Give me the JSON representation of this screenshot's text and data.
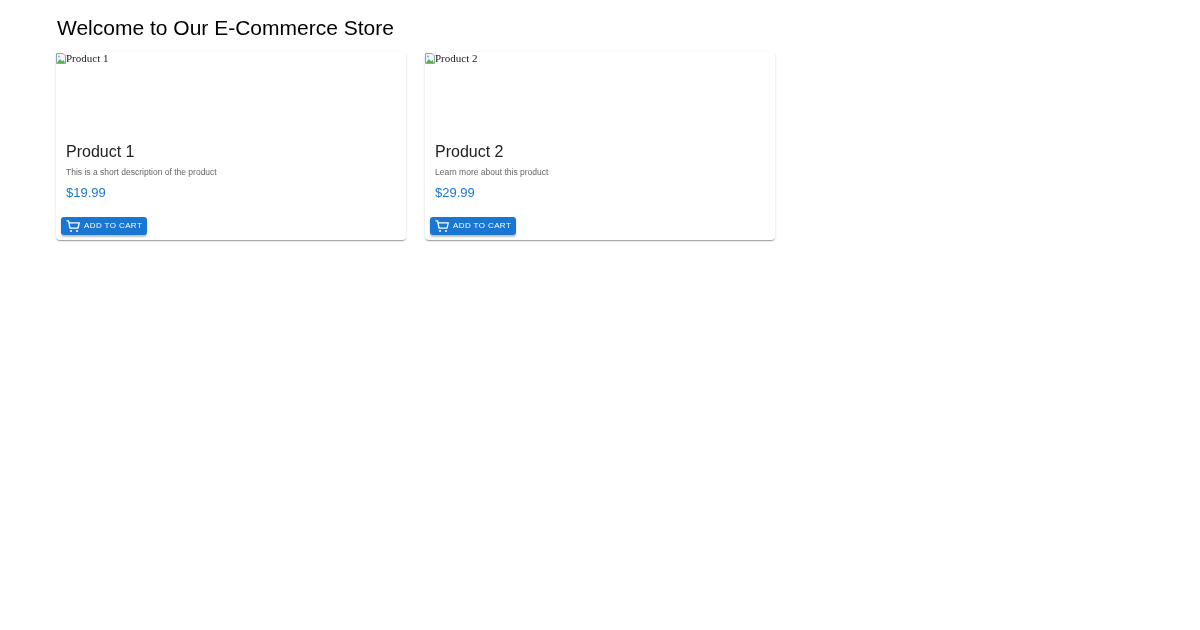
{
  "heading": "Welcome to Our E-Commerce Store",
  "products": [
    {
      "image_alt": "Product 1",
      "name": "Product 1",
      "description": "This is a short description of the product",
      "price": "$19.99",
      "button": "ADD TO CART"
    },
    {
      "image_alt": "Product 2",
      "name": "Product 2",
      "description": "Learn more about this product",
      "price": "$29.99",
      "button": "ADD TO CART"
    }
  ]
}
